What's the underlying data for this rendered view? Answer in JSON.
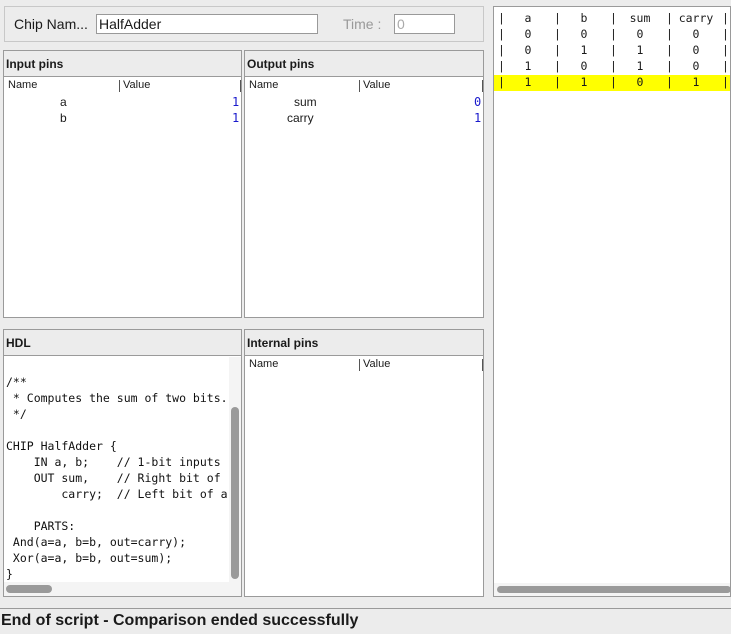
{
  "chip": {
    "label": "Chip Nam...",
    "value": "HalfAdder"
  },
  "time": {
    "label": "Time :",
    "value": "0"
  },
  "input_pins": {
    "title": "Input pins",
    "col_name": "Name",
    "col_value": "Value",
    "rows": [
      {
        "name": "a",
        "value": "1"
      },
      {
        "name": "b",
        "value": "1"
      }
    ]
  },
  "output_pins": {
    "title": "Output pins",
    "col_name": "Name",
    "col_value": "Value",
    "rows": [
      {
        "name": "sum",
        "value": "0"
      },
      {
        "name": "carry",
        "value": "1"
      }
    ]
  },
  "hdl": {
    "title": "HDL",
    "lines": [
      "/**",
      " * Computes the sum of two bits.",
      " */",
      "",
      "CHIP HalfAdder {",
      "    IN a, b;    // 1-bit inputs",
      "    OUT sum,    // Right bit of",
      "        carry;  // Left bit of a",
      "",
      "    PARTS:",
      " And(a=a, b=b, out=carry);",
      " Xor(a=a, b=b, out=sum);",
      "}"
    ]
  },
  "internal_pins": {
    "title": "Internal pins",
    "col_name": "Name",
    "col_value": "Value"
  },
  "compare": {
    "headers": [
      "a",
      "b",
      "sum",
      "carry"
    ],
    "rows": [
      [
        "0",
        "0",
        "0",
        "0"
      ],
      [
        "0",
        "1",
        "1",
        "0"
      ],
      [
        "1",
        "0",
        "1",
        "0"
      ],
      [
        "1",
        "1",
        "0",
        "1"
      ]
    ],
    "highlight_row": 3,
    "highlight_color": "#ffff00"
  },
  "status": "End of script - Comparison ended successfully"
}
